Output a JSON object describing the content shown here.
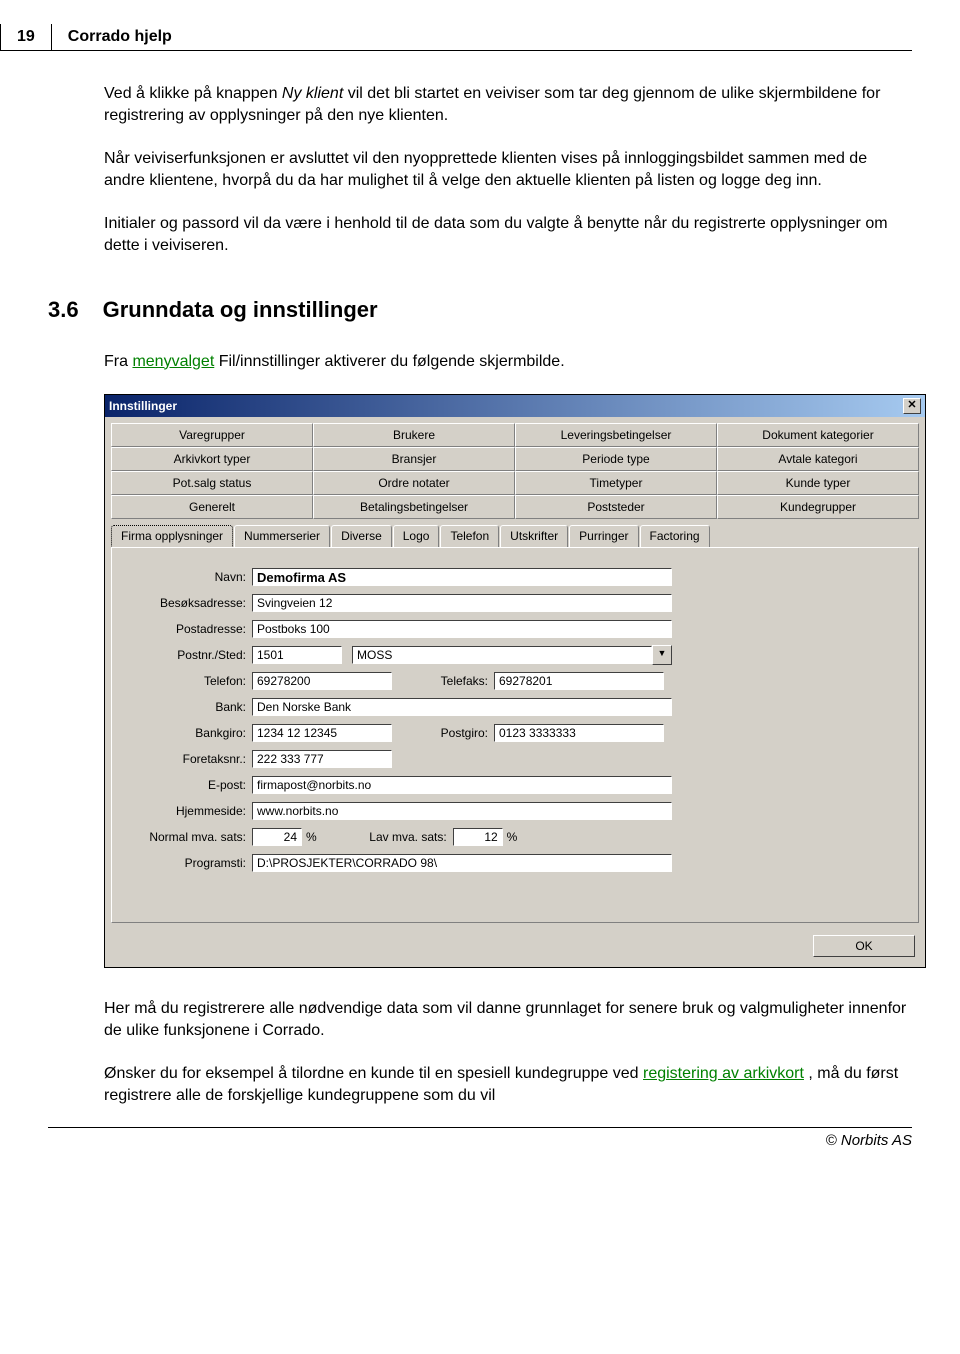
{
  "header": {
    "page_number": "19",
    "title": "Corrado hjelp"
  },
  "paragraphs": {
    "p1a": "Ved å klikke på knappen ",
    "p1_italic": "Ny klient",
    "p1b": " vil det bli startet en veiviser som tar deg gjennom de ulike skjermbildene for registrering av opplysninger på den nye klienten.",
    "p2": "Når veiviserfunksjonen er avsluttet vil den nyopprettede klienten vises på innloggingsbildet sammen med de andre klientene, hvorpå du da har mulighet til å velge den aktuelle klienten på listen og logge deg inn.",
    "p3": "Initialer og passord vil da være i henhold til de data som du valgte å benytte når du registrerte opplysninger om dette i veiviseren.",
    "p4a": "Fra ",
    "p4_link": "menyvalget",
    "p4b": " Fil/innstillinger aktiverer du følgende skjermbilde.",
    "p5": "Her må du registrerere alle nødvendige data som vil danne grunnlaget for senere bruk og valgmuligheter innenfor de ulike funksjonene i Corrado.",
    "p6a": "Ønsker du for eksempel å tilordne en kunde til en spesiell kundegruppe ved ",
    "p6_link": "registering av arkivkort",
    "p6b": " , må du først registrere alle de forskjellige kundegruppene som du vil"
  },
  "section": {
    "num": "3.6",
    "title": "Grunndata og innstillinger"
  },
  "dialog": {
    "title": "Innstillinger",
    "top_tabs": [
      "Varegrupper",
      "Brukere",
      "Leveringsbetingelser",
      "Dokument kategorier",
      "Arkivkort typer",
      "Bransjer",
      "Periode type",
      "Avtale kategori",
      "Pot.salg status",
      "Ordre notater",
      "Timetyper",
      "Kunde typer",
      "Generelt",
      "Betalingsbetingelser",
      "Poststeder",
      "Kundegrupper"
    ],
    "sub_tabs": [
      "Firma opplysninger",
      "Nummerserier",
      "Diverse",
      "Logo",
      "Telefon",
      "Utskrifter",
      "Purringer",
      "Factoring"
    ],
    "labels": {
      "navn": "Navn:",
      "besok": "Besøksadresse:",
      "post": "Postadresse:",
      "postnr": "Postnr./Sted:",
      "telefon": "Telefon:",
      "telefaks": "Telefaks:",
      "bank": "Bank:",
      "bankgiro": "Bankgiro:",
      "postgiro": "Postgiro:",
      "foretaksnr": "Foretaksnr.:",
      "epost": "E-post:",
      "hjemmeside": "Hjemmeside:",
      "mva": "Normal mva. sats:",
      "lavmva": "Lav mva. sats:",
      "programsti": "Programsti:",
      "pct": "%"
    },
    "values": {
      "navn": "Demofirma AS",
      "besok": "Svingveien 12",
      "post": "Postboks 100",
      "postnr": "1501",
      "sted": "MOSS",
      "telefon": "69278200",
      "telefaks": "69278201",
      "bank": "Den Norske Bank",
      "bankgiro": "1234 12 12345",
      "postgiro": "0123 3333333",
      "foretaksnr": "222 333 777",
      "epost": "firmapost@norbits.no",
      "hjemmeside": "www.norbits.no",
      "mva": "24",
      "lavmva": "12",
      "programsti": "D:\\PROSJEKTER\\CORRADO 98\\"
    },
    "ok": "OK"
  },
  "footer": "© Norbits AS"
}
